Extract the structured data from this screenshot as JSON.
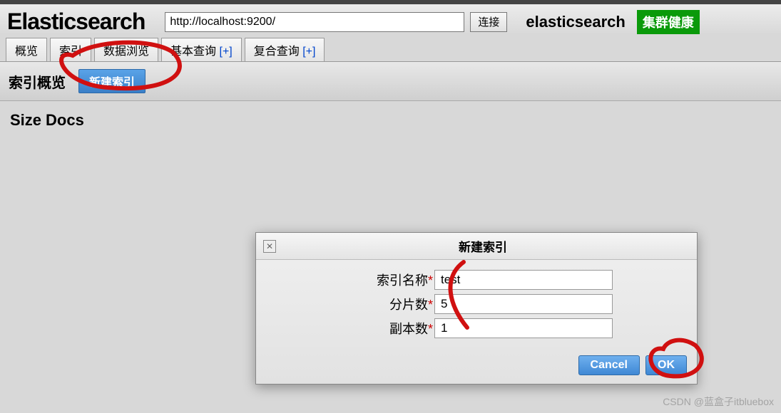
{
  "header": {
    "logo": "Elasticsearch",
    "url_value": "http://localhost:9200/",
    "connect_label": "连接",
    "cluster_name": "elasticsearch",
    "health_label": "集群健康"
  },
  "tabs": {
    "overview": "概览",
    "indices": "索引",
    "browse": "数据浏览",
    "basic_query": "基本查询",
    "compound_query": "复合查询",
    "plus": "[+]"
  },
  "subheader": {
    "title": "索引概览",
    "new_index_label": "新建索引"
  },
  "table": {
    "col_size": "Size",
    "col_docs": "Docs"
  },
  "dialog": {
    "title": "新建索引",
    "fields": {
      "index_name": {
        "label": "索引名称",
        "value": "test"
      },
      "shards": {
        "label": "分片数",
        "value": "5"
      },
      "replicas": {
        "label": "副本数",
        "value": "1"
      }
    },
    "required_mark": "*",
    "cancel_label": "Cancel",
    "ok_label": "OK"
  },
  "watermark": "CSDN @蓝盒子itbluebox"
}
